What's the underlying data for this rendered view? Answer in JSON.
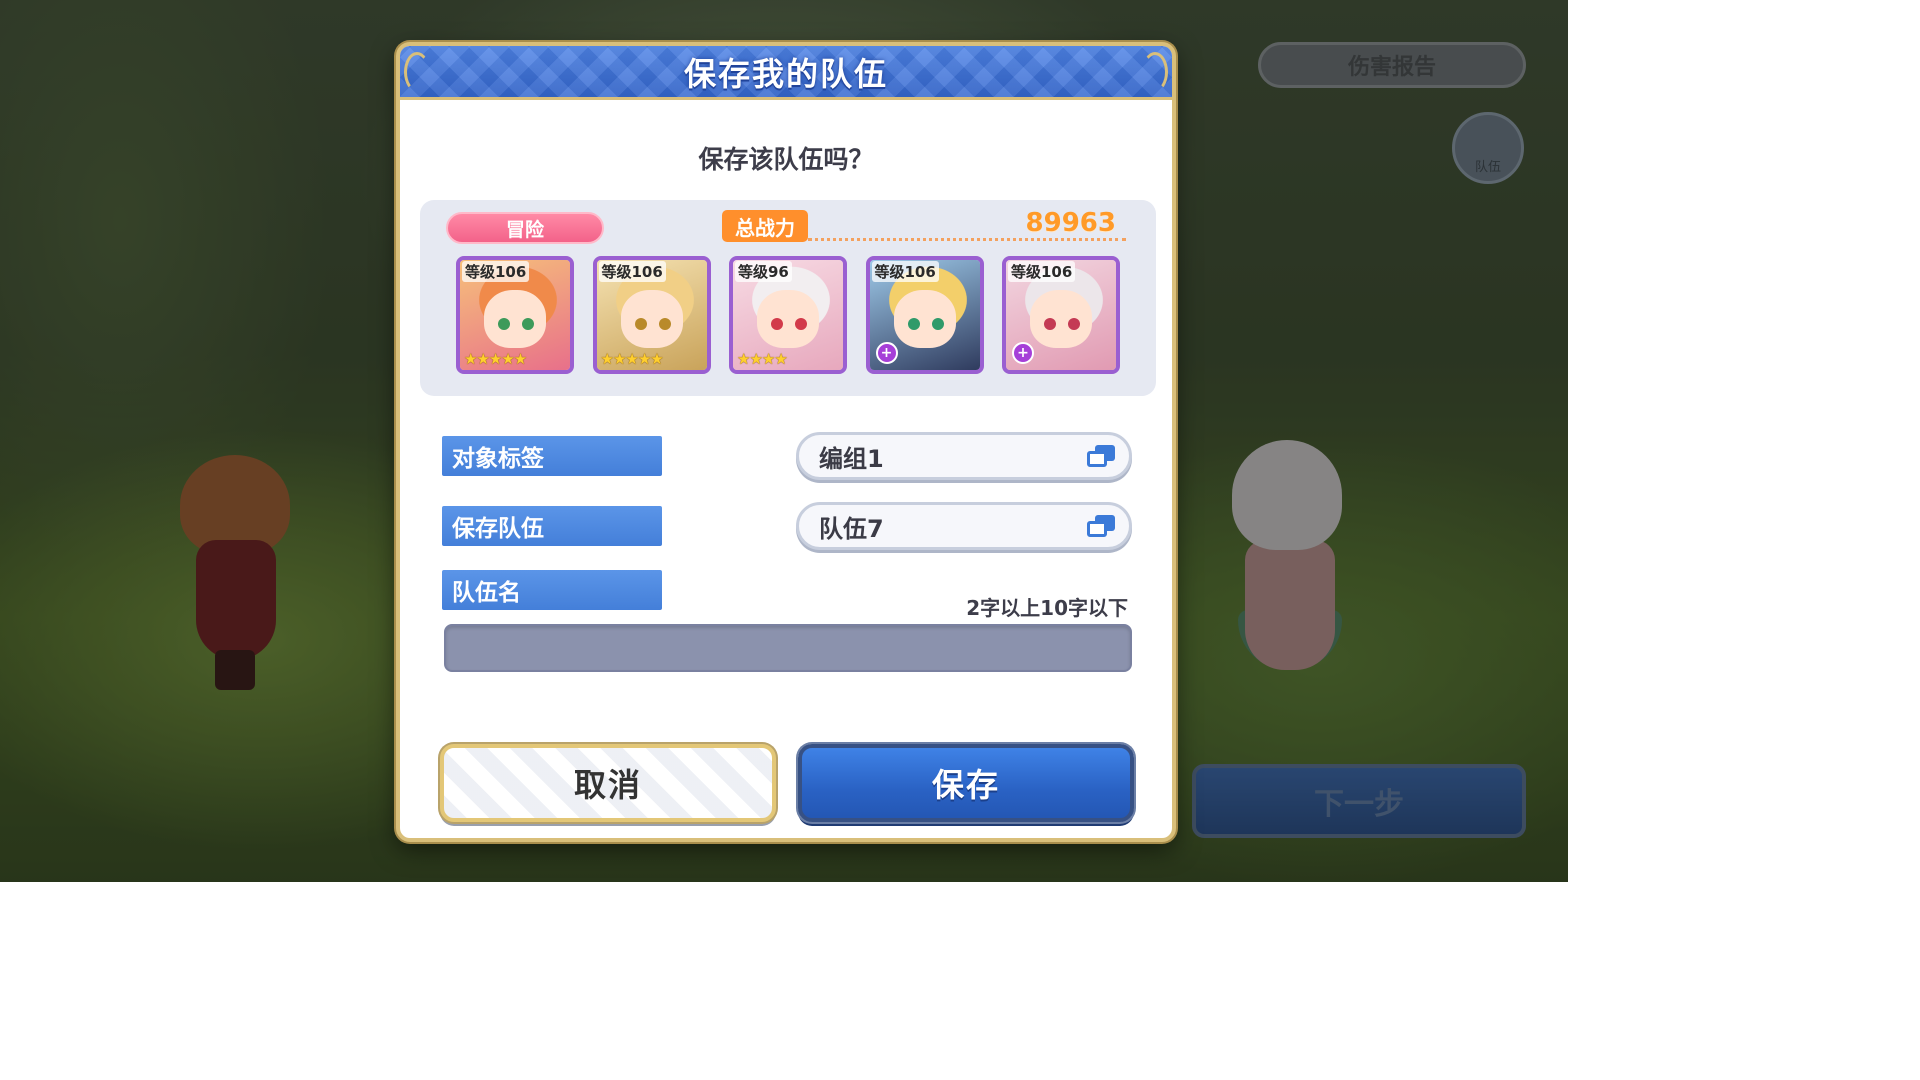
{
  "background": {
    "damage_report_label": "伤害报告",
    "side_icon_label": "队伍",
    "next_button_label": "下一步"
  },
  "dialog": {
    "title": "保存我的队伍",
    "question": "保存该队伍吗？",
    "party": {
      "mode_label": "冒险",
      "power_label": "总战力",
      "power_value": "89963",
      "units": [
        {
          "level": "等级106",
          "stars": "★★★★★",
          "ue_badge": "",
          "hair": "#f08a4a",
          "accent": "#e8708a",
          "eye": "#3d9a5a",
          "frame_bg": "#f6c07a"
        },
        {
          "level": "等级106",
          "stars": "★★★★★",
          "ue_badge": "",
          "hair": "#f1cf86",
          "accent": "#c9a35a",
          "eye": "#b98a2a",
          "frame_bg": "#f5e2b2"
        },
        {
          "level": "等级96",
          "stars": "★★★★",
          "ue_badge": "",
          "hair": "#f2eef0",
          "accent": "#e7a8bd",
          "eye": "#d23a4a",
          "frame_bg": "#f7dbe4"
        },
        {
          "level": "等级106",
          "stars": "",
          "ue_badge": "+",
          "hair": "#f3cf6a",
          "accent": "#2f3b5e",
          "eye": "#2f9a6a",
          "frame_bg": "#9ec9e8"
        },
        {
          "level": "等级106",
          "stars": "",
          "ue_badge": "+",
          "hair": "#ece6ea",
          "accent": "#e19ab2",
          "eye": "#c43a54",
          "frame_bg": "#f2d6e0"
        }
      ]
    },
    "target_tag": {
      "label": "对象标签",
      "value": "编组1"
    },
    "save_party": {
      "label": "保存队伍",
      "value": "队伍7"
    },
    "party_name": {
      "label": "队伍名",
      "hint": "2字以上10字以下",
      "value": "",
      "placeholder": ""
    },
    "cancel_label": "取消",
    "save_label": "保存"
  },
  "colors": {
    "header_blue": "#3f74db",
    "label_blue": "#4f8ae2",
    "mode_pink": "#f3628a",
    "power_orange": "#ff8f2c",
    "unit_frame_purple": "#9a5fd1",
    "input_gray": "#8b92ad"
  }
}
